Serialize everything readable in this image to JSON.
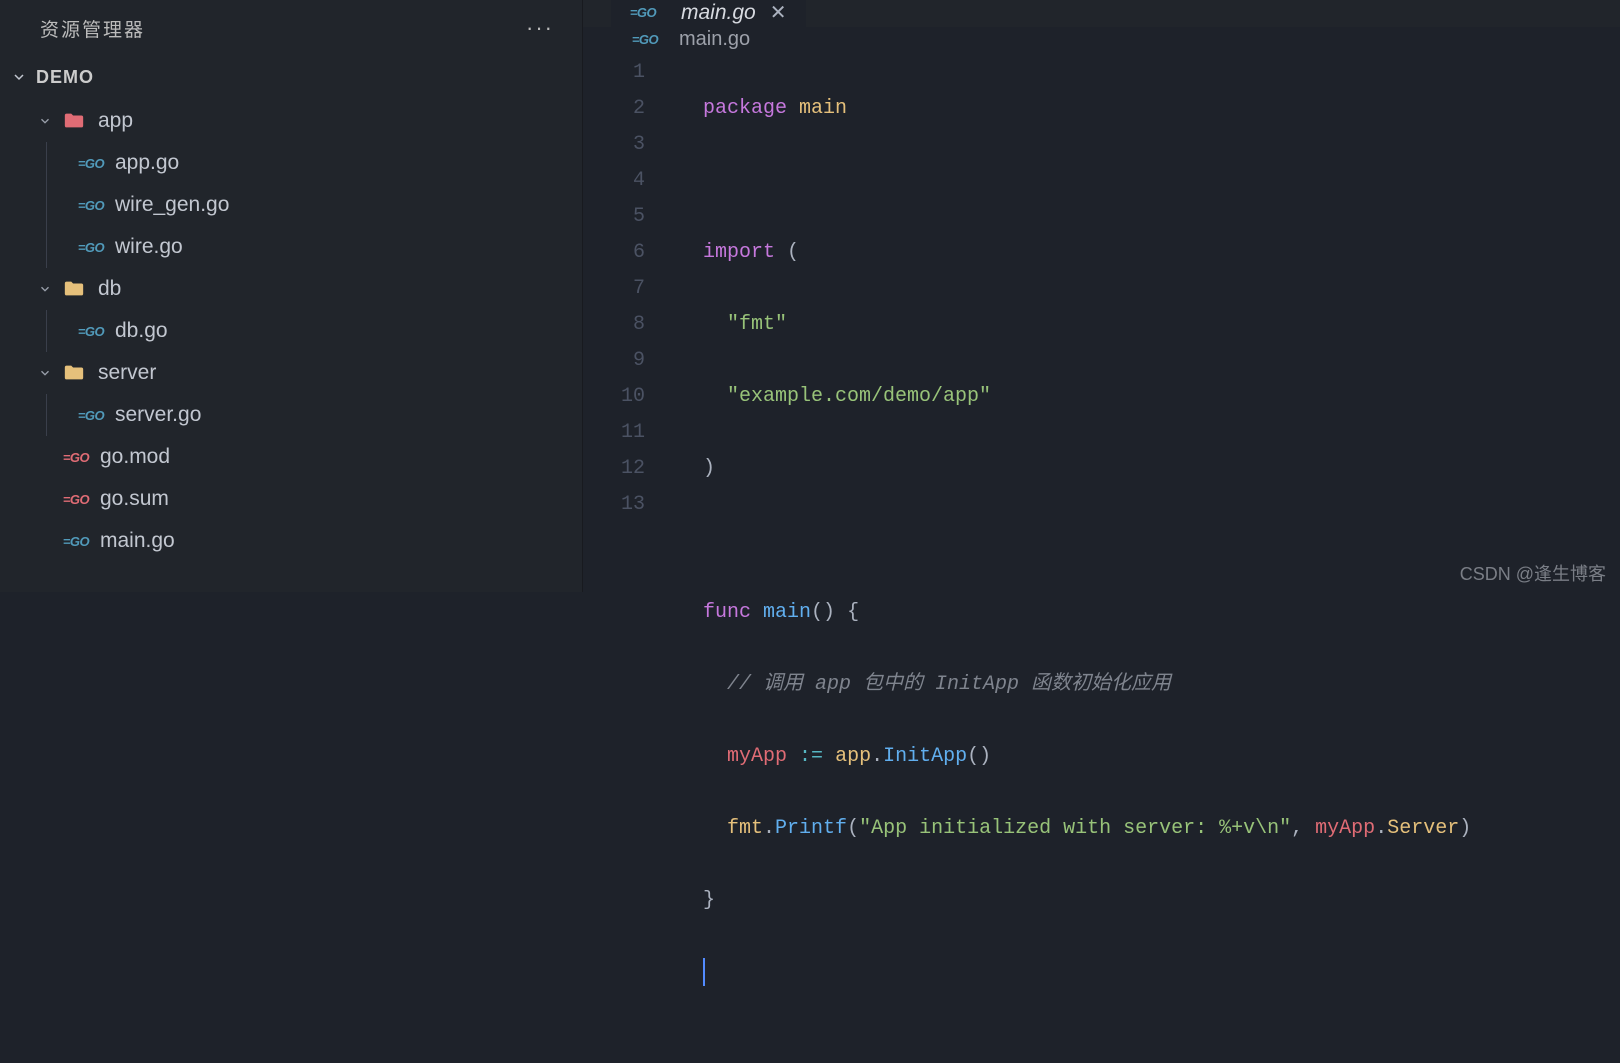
{
  "sidebar": {
    "title": "资源管理器",
    "project": "DEMO",
    "tree": [
      {
        "type": "folder",
        "name": "app",
        "color": "red"
      },
      {
        "type": "file",
        "name": "app.go",
        "icon": "go"
      },
      {
        "type": "file",
        "name": "wire_gen.go",
        "icon": "go"
      },
      {
        "type": "file",
        "name": "wire.go",
        "icon": "go"
      },
      {
        "type": "folder",
        "name": "db",
        "color": "yellow"
      },
      {
        "type": "file",
        "name": "db.go",
        "icon": "go"
      },
      {
        "type": "folder",
        "name": "server",
        "color": "yellow"
      },
      {
        "type": "file",
        "name": "server.go",
        "icon": "go"
      },
      {
        "type": "rootfile",
        "name": "go.mod",
        "icon": "gopink"
      },
      {
        "type": "rootfile",
        "name": "go.sum",
        "icon": "gopink"
      },
      {
        "type": "rootfile",
        "name": "main.go",
        "icon": "go"
      }
    ]
  },
  "tab": {
    "title": "main.go"
  },
  "breadcrumb": {
    "file": "main.go"
  },
  "code": {
    "lines": [
      "1",
      "2",
      "3",
      "4",
      "5",
      "6",
      "7",
      "8",
      "9",
      "10",
      "11",
      "12",
      "13"
    ],
    "l1_package": "package",
    "l1_main": "main",
    "l3_import": "import",
    "l3_paren": "(",
    "l4_fmt": "\"fmt\"",
    "l5_app": "\"example.com/demo/app\"",
    "l6_paren": ")",
    "l8_func": "func",
    "l8_main": "main",
    "l8_parens": "()",
    "l8_brace": "{",
    "l9_comment": "// 调用 app 包中的 InitApp 函数初始化应用",
    "l10_var": "myApp",
    "l10_op": ":=",
    "l10_pkg": "app",
    "l10_dot": ".",
    "l10_fn": "InitApp",
    "l10_call": "()",
    "l11_pkg": "fmt",
    "l11_dot": ".",
    "l11_fn": "Printf",
    "l11_open": "(",
    "l11_str": "\"App initialized with server: %+v\\n\"",
    "l11_comma": ", ",
    "l11_var": "myApp",
    "l11_dot2": ".",
    "l11_field": "Server",
    "l11_close": ")",
    "l12_brace": "}"
  },
  "watermark": "CSDN @逢生博客"
}
